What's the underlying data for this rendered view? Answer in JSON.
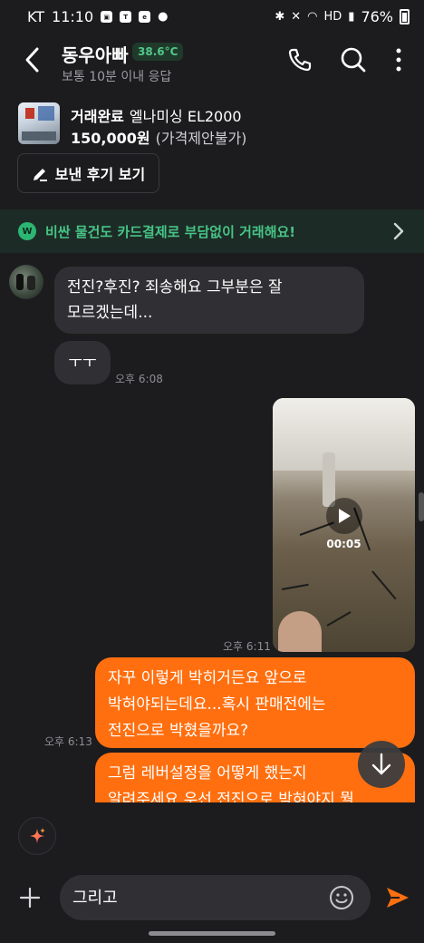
{
  "status_bar": {
    "carrier": "KT",
    "time": "11:10",
    "battery": "76%"
  },
  "header": {
    "name": "동우아빠",
    "temperature": "38.6°C",
    "response_time": "보통 10분 이내 응답"
  },
  "product": {
    "status": "거래완료",
    "title": "엘나미싱 EL2000",
    "price": "150,000원",
    "negotiable": "(가격제안불가)",
    "review_button": "보낸 후기 보기"
  },
  "banner": {
    "text": "비싼 물건도 카드결제로 부담없이 거래해요!",
    "icon_letter": "W"
  },
  "messages": [
    {
      "direction": "in",
      "text_line1": "전진?후진? 죄송해요 그부분은 잘",
      "text_line2": "모르겠는데..."
    },
    {
      "direction": "in",
      "text": "ㅜㅜ",
      "time": "오후 6:08"
    },
    {
      "direction": "out",
      "type": "video",
      "duration": "00:05",
      "time": "오후 6:11"
    },
    {
      "direction": "out",
      "text_line1": "자꾸 이렇게 박히거든요 앞으로",
      "text_line2": "박혀야되는데요...혹시 판매전에는",
      "text_line3": "전진으로 박혔을까요?",
      "time": "오후 6:13"
    },
    {
      "direction": "out",
      "text_line1": "그럼 레버설정을 어떻게 했는지",
      "text_line2": "알려주세요 우선 전진으로 박혀야지 뭘"
    }
  ],
  "composer": {
    "input_value": "그리고"
  },
  "colors": {
    "background": "#1c1c1e",
    "bubble_in": "#303034",
    "bubble_out": "#ff6f0f",
    "accent_green": "#46c486"
  }
}
